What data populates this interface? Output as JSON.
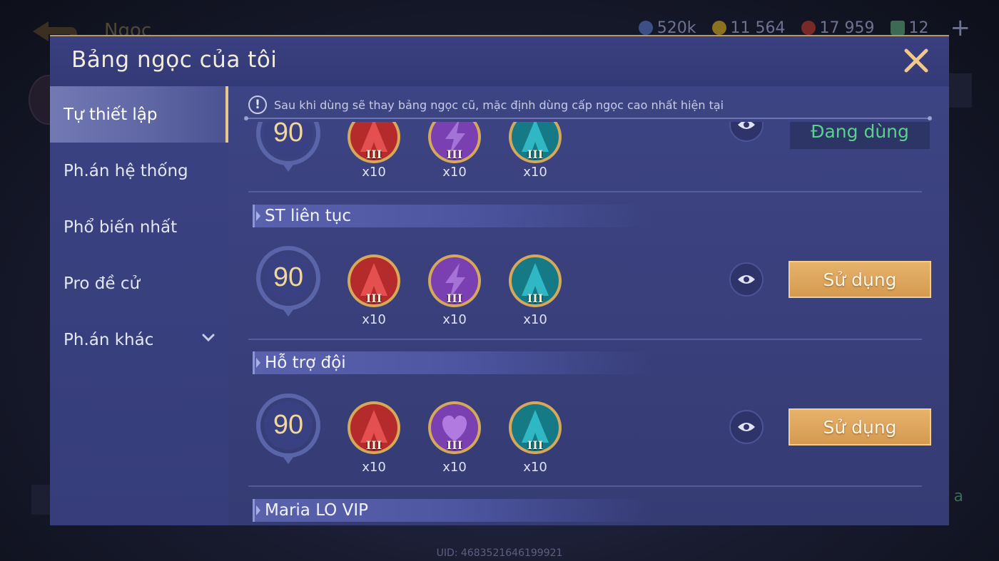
{
  "background": {
    "page_title": "Ngọc",
    "resources": [
      {
        "icon": "crystal-icon",
        "value": "520k"
      },
      {
        "icon": "gold-coin-icon",
        "value": "11 564"
      },
      {
        "icon": "ruby-icon",
        "value": "17 959"
      },
      {
        "icon": "card-icon",
        "value": "12"
      }
    ],
    "right_partial_text": "a",
    "uid": "UID: 4683521646199921"
  },
  "modal": {
    "title": "Bảng ngọc của tôi",
    "notice": "Sau khi dùng sẽ thay bảng ngọc cũ, mặc định dùng cấp ngọc cao nhất hiện tại"
  },
  "sidebar": {
    "items": [
      {
        "label": "Tự thiết lập",
        "active": true
      },
      {
        "label": "Ph.án hệ thống"
      },
      {
        "label": "Phổ biến nhất"
      },
      {
        "label": "Pro đề cử"
      },
      {
        "label": "Ph.án khác",
        "has_dropdown": true
      }
    ]
  },
  "pages": [
    {
      "name": "",
      "level": "90",
      "partial": true,
      "gems": [
        {
          "color": "red",
          "symbol": "mage",
          "tier": "III",
          "count": "x10"
        },
        {
          "color": "purple",
          "symbol": "lightning",
          "tier": "III",
          "count": "x10"
        },
        {
          "color": "teal",
          "symbol": "mage",
          "tier": "III",
          "count": "x10"
        }
      ],
      "status": "Đang dùng"
    },
    {
      "name": "ST liên tục",
      "level": "90",
      "gems": [
        {
          "color": "red",
          "symbol": "mage",
          "tier": "III",
          "count": "x10"
        },
        {
          "color": "purple",
          "symbol": "lightning",
          "tier": "III",
          "count": "x10"
        },
        {
          "color": "teal",
          "symbol": "mage",
          "tier": "III",
          "count": "x10"
        }
      ],
      "action": "Sử dụng"
    },
    {
      "name": "Hỗ trợ đội",
      "level": "90",
      "gems": [
        {
          "color": "red",
          "symbol": "mage",
          "tier": "III",
          "count": "x10"
        },
        {
          "color": "purple",
          "symbol": "heart",
          "tier": "III",
          "count": "x10"
        },
        {
          "color": "teal",
          "symbol": "mage",
          "tier": "III",
          "count": "x10"
        }
      ],
      "action": "Sử dụng"
    },
    {
      "name": "Maria LO VIP"
    }
  ],
  "colors": {
    "red": "#b52a2a",
    "purple": "#7a3fb0",
    "teal": "#167a86",
    "accent_gold": "#e9c789",
    "in_use_green": "#58d28d"
  }
}
